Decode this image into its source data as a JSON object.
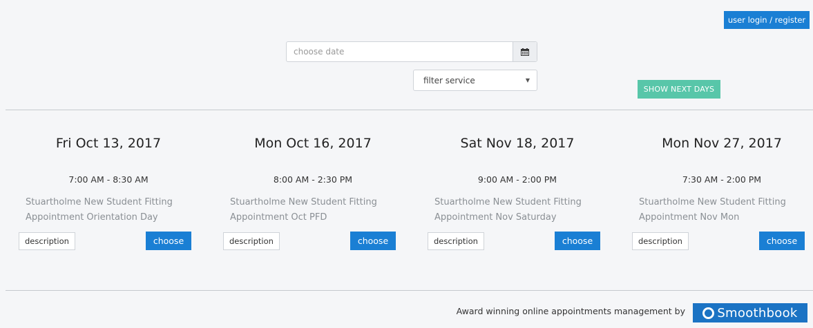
{
  "header": {
    "login_label": "user login / register"
  },
  "filters": {
    "date_placeholder": "choose date",
    "date_value": "",
    "calendar_icon": "calendar-icon",
    "service_selected": "filter service",
    "show_next_label": "SHOW NEXT DAYS"
  },
  "slots": [
    {
      "date": "Fri Oct 13, 2017",
      "time": "7:00 AM - 8:30 AM",
      "service_line1": "Stuartholme New Student Fitting",
      "service_line2": "Appointment Orientation Day",
      "description_label": "description",
      "choose_label": "choose"
    },
    {
      "date": "Mon Oct 16, 2017",
      "time": "8:00 AM - 2:30 PM",
      "service_line1": "Stuartholme New Student Fitting",
      "service_line2": "Appointment Oct PFD",
      "description_label": "description",
      "choose_label": "choose"
    },
    {
      "date": "Sat Nov 18, 2017",
      "time": "9:00 AM - 2:00 PM",
      "service_line1": "Stuartholme New Student Fitting",
      "service_line2": "Appointment Nov Saturday",
      "description_label": "description",
      "choose_label": "choose"
    },
    {
      "date": "Mon Nov 27, 2017",
      "time": "7:30 AM - 2:00 PM",
      "service_line1": "Stuartholme New Student Fitting",
      "service_line2": "Appointment Nov Mon",
      "description_label": "description",
      "choose_label": "choose"
    }
  ],
  "footer": {
    "tagline": "Award winning online appointments management by",
    "brand": "Smoothbook"
  },
  "colors": {
    "background": "#f5f6f8",
    "primary_blue": "#1a7fd4",
    "accent_green": "#58c6a9",
    "brand_blue": "#1b73c4",
    "service_text": "#8a8f94"
  }
}
